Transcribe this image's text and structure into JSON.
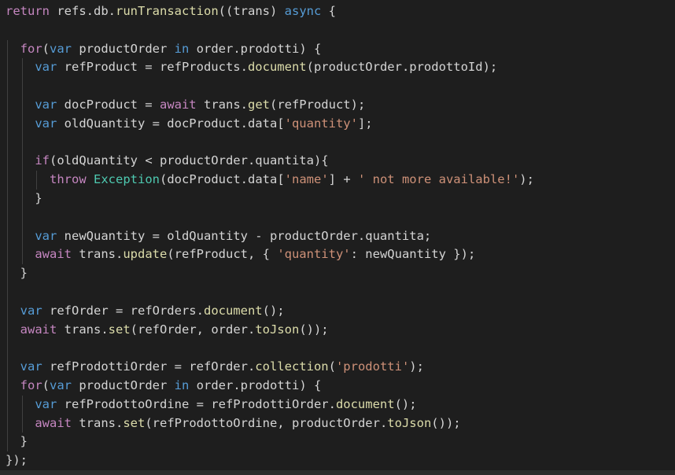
{
  "editor": {
    "background": "#1e1e1e",
    "theme_colors": {
      "text": "#d4d4d4",
      "keyword_blue": "#569cd6",
      "control_purple": "#c586c0",
      "function_yellow": "#dcdcaa",
      "string_orange": "#ce9178",
      "class_teal": "#4ec9b0"
    },
    "lines": [
      {
        "indent": 0,
        "tokens": [
          {
            "t": "return",
            "c": "ctl"
          },
          {
            "t": " refs.db.",
            "c": "plain"
          },
          {
            "t": "runTransaction",
            "c": "fn"
          },
          {
            "t": "((trans) ",
            "c": "plain"
          },
          {
            "t": "async",
            "c": "kw"
          },
          {
            "t": " {",
            "c": "plain"
          }
        ]
      },
      {
        "indent": 0,
        "tokens": []
      },
      {
        "indent": 1,
        "tokens": [
          {
            "t": "for",
            "c": "ctl"
          },
          {
            "t": "(",
            "c": "plain"
          },
          {
            "t": "var",
            "c": "kw"
          },
          {
            "t": " productOrder ",
            "c": "plain"
          },
          {
            "t": "in",
            "c": "kw"
          },
          {
            "t": " order.prodotti) {",
            "c": "plain"
          }
        ]
      },
      {
        "indent": 2,
        "tokens": [
          {
            "t": "var",
            "c": "kw"
          },
          {
            "t": " refProduct = refProducts.",
            "c": "plain"
          },
          {
            "t": "document",
            "c": "fn"
          },
          {
            "t": "(productOrder.prodottoId);",
            "c": "plain"
          }
        ]
      },
      {
        "indent": 0,
        "tokens": []
      },
      {
        "indent": 2,
        "tokens": [
          {
            "t": "var",
            "c": "kw"
          },
          {
            "t": " docProduct = ",
            "c": "plain"
          },
          {
            "t": "await",
            "c": "ctl"
          },
          {
            "t": " trans.",
            "c": "plain"
          },
          {
            "t": "get",
            "c": "fn"
          },
          {
            "t": "(refProduct);",
            "c": "plain"
          }
        ]
      },
      {
        "indent": 2,
        "tokens": [
          {
            "t": "var",
            "c": "kw"
          },
          {
            "t": " oldQuantity = docProduct.data[",
            "c": "plain"
          },
          {
            "t": "'quantity'",
            "c": "str"
          },
          {
            "t": "];",
            "c": "plain"
          }
        ]
      },
      {
        "indent": 0,
        "tokens": []
      },
      {
        "indent": 2,
        "tokens": [
          {
            "t": "if",
            "c": "ctl"
          },
          {
            "t": "(oldQuantity < productOrder.quantita){",
            "c": "plain"
          }
        ]
      },
      {
        "indent": 3,
        "tokens": [
          {
            "t": "throw",
            "c": "ctl"
          },
          {
            "t": " ",
            "c": "plain"
          },
          {
            "t": "Exception",
            "c": "cls"
          },
          {
            "t": "(docProduct.data[",
            "c": "plain"
          },
          {
            "t": "'name'",
            "c": "str"
          },
          {
            "t": "] + ",
            "c": "plain"
          },
          {
            "t": "' not more available!'",
            "c": "str"
          },
          {
            "t": ");",
            "c": "plain"
          }
        ]
      },
      {
        "indent": 2,
        "tokens": [
          {
            "t": "}",
            "c": "plain"
          }
        ]
      },
      {
        "indent": 0,
        "tokens": []
      },
      {
        "indent": 2,
        "tokens": [
          {
            "t": "var",
            "c": "kw"
          },
          {
            "t": " newQuantity = oldQuantity - productOrder.quantita;",
            "c": "plain"
          }
        ]
      },
      {
        "indent": 2,
        "tokens": [
          {
            "t": "await",
            "c": "ctl"
          },
          {
            "t": " trans.",
            "c": "plain"
          },
          {
            "t": "update",
            "c": "fn"
          },
          {
            "t": "(refProduct, { ",
            "c": "plain"
          },
          {
            "t": "'quantity'",
            "c": "str"
          },
          {
            "t": ": newQuantity });",
            "c": "plain"
          }
        ]
      },
      {
        "indent": 1,
        "tokens": [
          {
            "t": "}",
            "c": "plain"
          }
        ]
      },
      {
        "indent": 0,
        "tokens": []
      },
      {
        "indent": 1,
        "tokens": [
          {
            "t": "var",
            "c": "kw"
          },
          {
            "t": " refOrder = refOrders.",
            "c": "plain"
          },
          {
            "t": "document",
            "c": "fn"
          },
          {
            "t": "();",
            "c": "plain"
          }
        ]
      },
      {
        "indent": 1,
        "tokens": [
          {
            "t": "await",
            "c": "ctl"
          },
          {
            "t": " trans.",
            "c": "plain"
          },
          {
            "t": "set",
            "c": "fn"
          },
          {
            "t": "(refOrder, order.",
            "c": "plain"
          },
          {
            "t": "toJson",
            "c": "fn"
          },
          {
            "t": "());",
            "c": "plain"
          }
        ]
      },
      {
        "indent": 0,
        "tokens": []
      },
      {
        "indent": 1,
        "tokens": [
          {
            "t": "var",
            "c": "kw"
          },
          {
            "t": " refProdottiOrder = refOrder.",
            "c": "plain"
          },
          {
            "t": "collection",
            "c": "fn"
          },
          {
            "t": "(",
            "c": "plain"
          },
          {
            "t": "'prodotti'",
            "c": "str"
          },
          {
            "t": ");",
            "c": "plain"
          }
        ]
      },
      {
        "indent": 1,
        "tokens": [
          {
            "t": "for",
            "c": "ctl"
          },
          {
            "t": "(",
            "c": "plain"
          },
          {
            "t": "var",
            "c": "kw"
          },
          {
            "t": " productOrder ",
            "c": "plain"
          },
          {
            "t": "in",
            "c": "kw"
          },
          {
            "t": " order.prodotti) {",
            "c": "plain"
          }
        ]
      },
      {
        "indent": 2,
        "tokens": [
          {
            "t": "var",
            "c": "kw"
          },
          {
            "t": " refProdottoOrdine = refProdottiOrder.",
            "c": "plain"
          },
          {
            "t": "document",
            "c": "fn"
          },
          {
            "t": "();",
            "c": "plain"
          }
        ]
      },
      {
        "indent": 2,
        "tokens": [
          {
            "t": "await",
            "c": "ctl"
          },
          {
            "t": " trans.",
            "c": "plain"
          },
          {
            "t": "set",
            "c": "fn"
          },
          {
            "t": "(refProdottoOrdine, productOrder.",
            "c": "plain"
          },
          {
            "t": "toJson",
            "c": "fn"
          },
          {
            "t": "());",
            "c": "plain"
          }
        ]
      },
      {
        "indent": 1,
        "tokens": [
          {
            "t": "}",
            "c": "plain"
          }
        ]
      },
      {
        "indent": 0,
        "tokens": [
          {
            "t": "});",
            "c": "plain"
          }
        ]
      }
    ]
  }
}
